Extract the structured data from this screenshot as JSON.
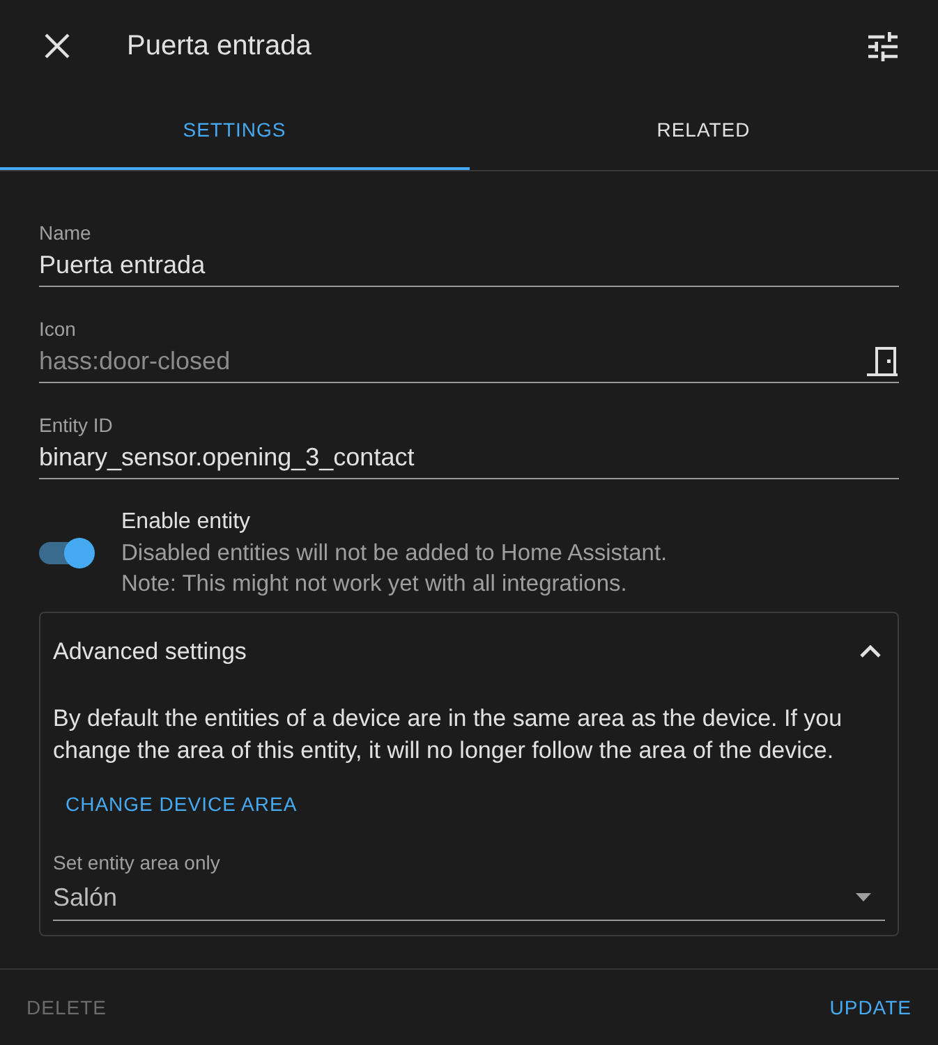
{
  "dialog": {
    "title": "Puerta entrada"
  },
  "tabs": [
    {
      "label": "SETTINGS",
      "selected": true
    },
    {
      "label": "RELATED",
      "selected": false
    }
  ],
  "fields": [
    {
      "kind": "text",
      "label": "Name",
      "value": "Puerta entrada"
    },
    {
      "kind": "icon",
      "label": "Icon",
      "placeholder": "hass:door-closed"
    },
    {
      "kind": "text",
      "label": "Entity ID",
      "value": "binary_sensor.opening_3_contact"
    }
  ],
  "enable": {
    "label": "Enable entity",
    "on": true,
    "description": [
      "Disabled entities will not be added to Home Assistant.",
      "Note: This might not work yet with all integrations."
    ]
  },
  "advanced": {
    "title": "Advanced settings",
    "expanded": true,
    "text": "By default the entities of a device are in the same area as the device. If you change the area of this entity, it will no longer follow the area of the device.",
    "button": "CHANGE DEVICE AREA",
    "select": {
      "label": "Set entity area only",
      "value": "Salón"
    }
  },
  "footer": {
    "buttons": [
      {
        "label": "DELETE",
        "disabled": true
      },
      {
        "label": "UPDATE",
        "disabled": false
      }
    ]
  }
}
